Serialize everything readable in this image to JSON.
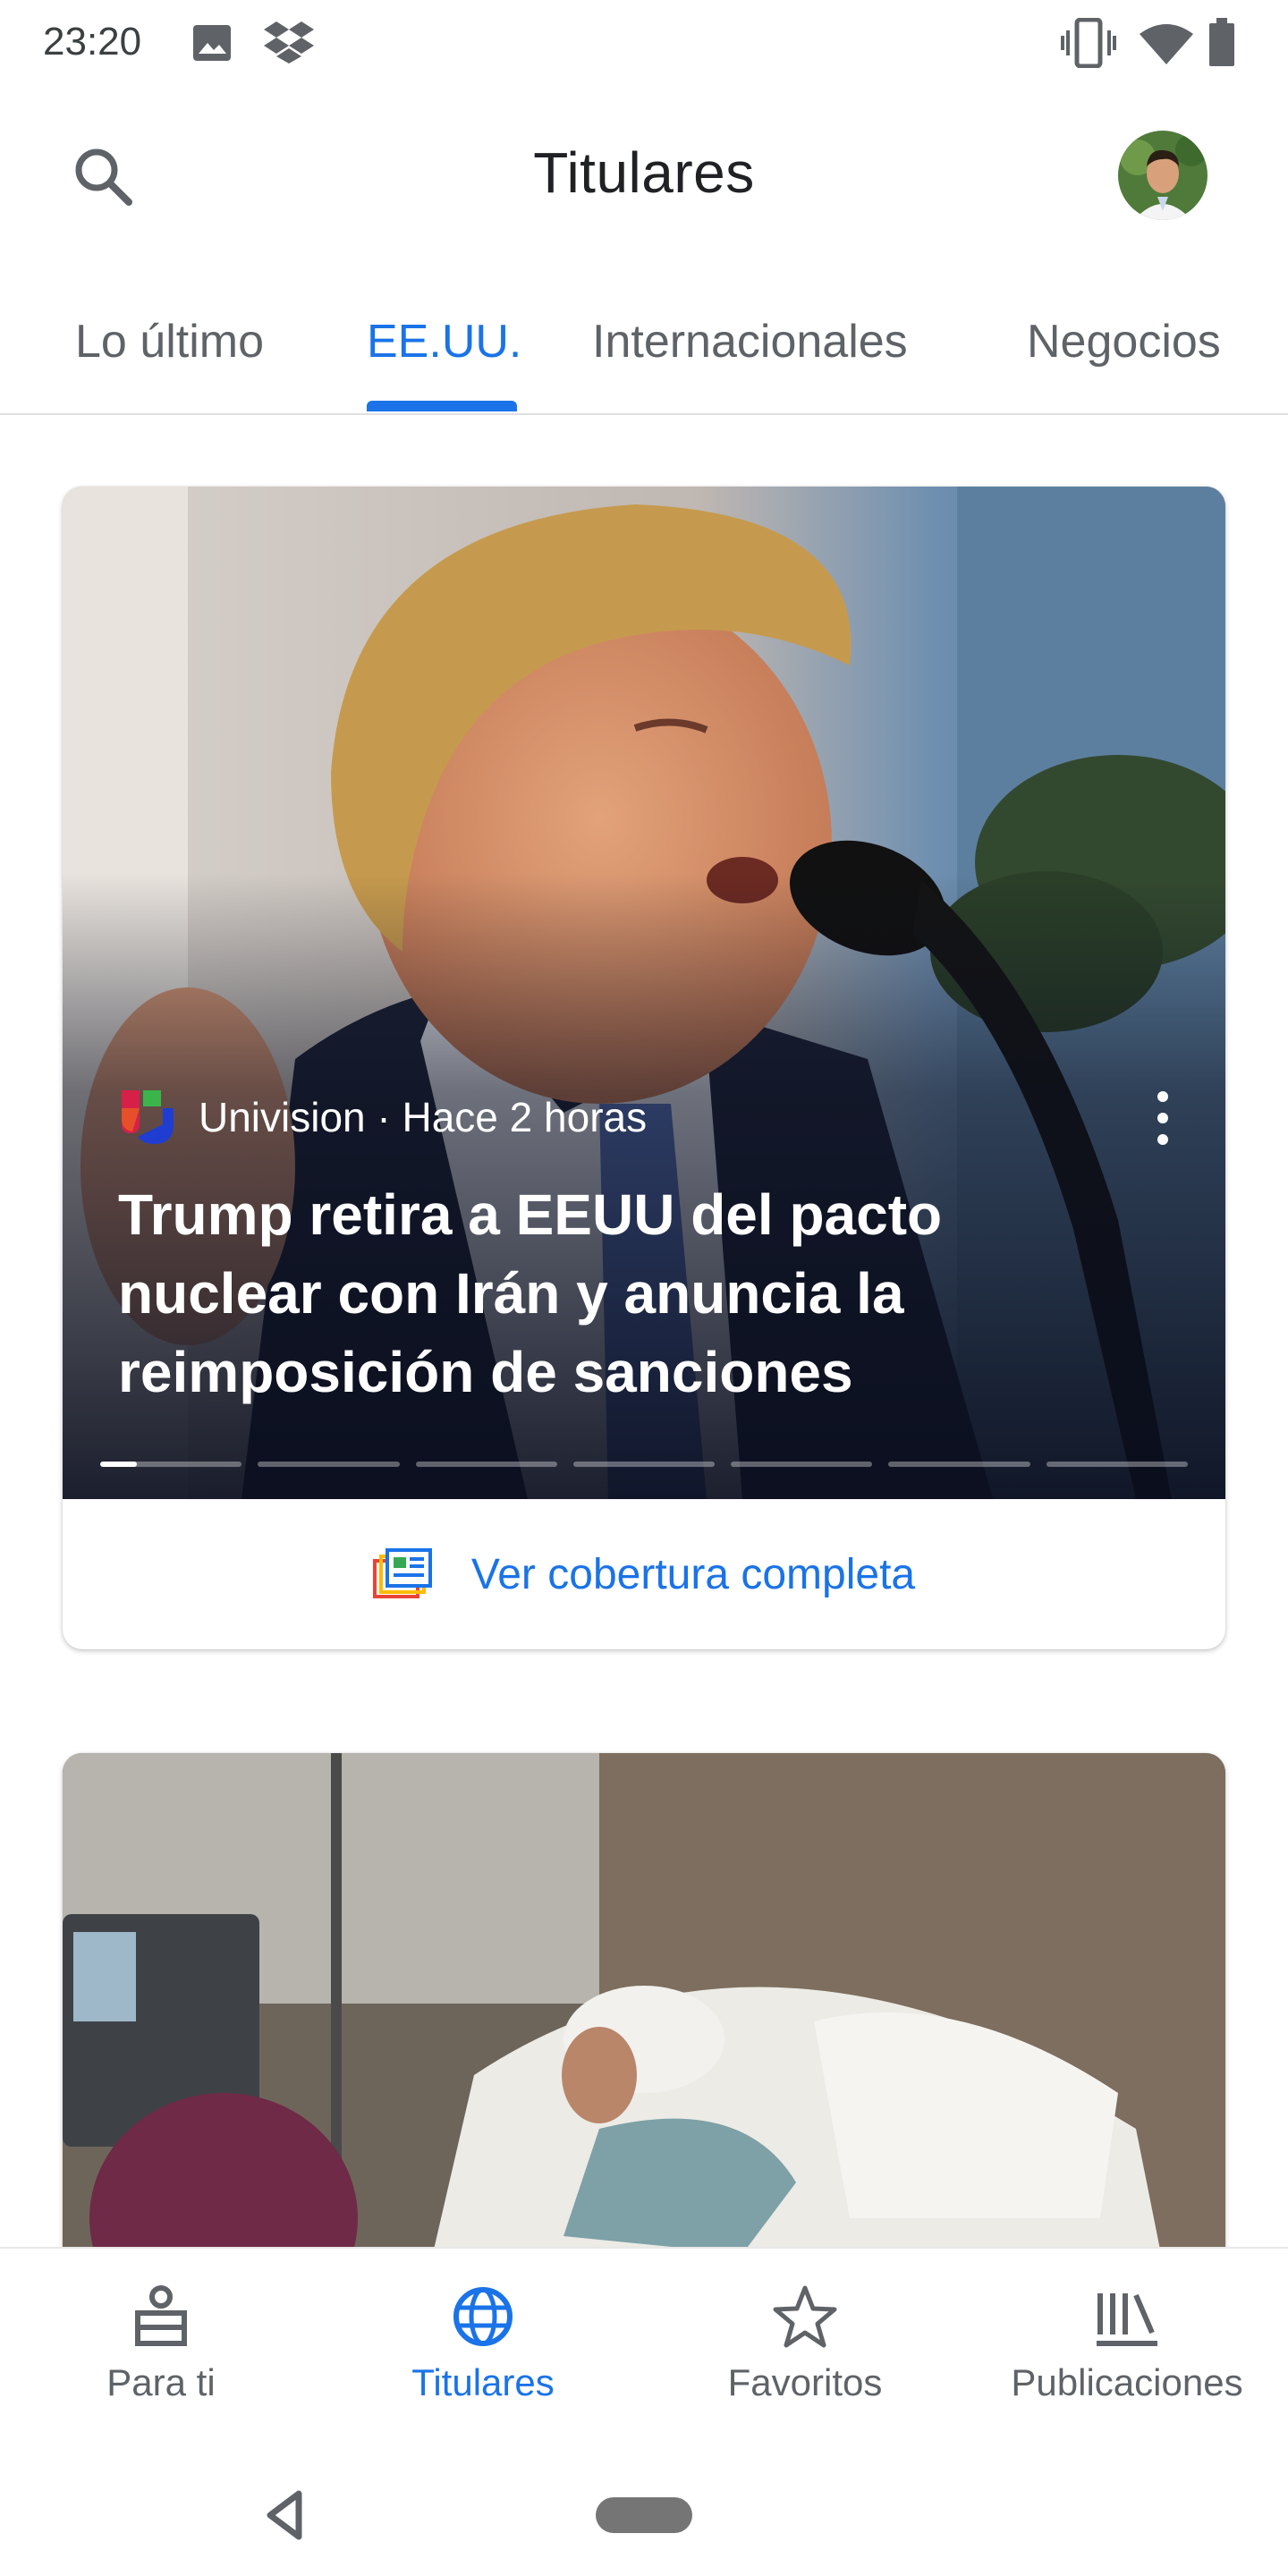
{
  "status_bar": {
    "time": "23:20",
    "icons": [
      "image-icon",
      "dropbox-icon",
      "vibrate-icon",
      "wifi-icon",
      "battery-icon"
    ]
  },
  "app_bar": {
    "title": "Titulares",
    "search_icon": "search-icon",
    "avatar": "account-avatar"
  },
  "tabs": [
    {
      "label": "Lo último",
      "active": false
    },
    {
      "label": "EE.UU.",
      "active": true
    },
    {
      "label": "Internacionales",
      "active": false
    },
    {
      "label": "Negocios",
      "active": false
    }
  ],
  "stories": [
    {
      "source": "Univision",
      "time": "Hace 2 horas",
      "source_line": "Univision · Hace 2 horas",
      "headline": "Trump retira a EEUU del pacto nuclear con Irán y anuncia la reimposición de sanciones",
      "carousel_position": 1,
      "carousel_count": 7,
      "coverage_label": "Ver cobertura completa"
    }
  ],
  "bottom_nav": [
    {
      "label": "Para ti",
      "icon": "for-you-icon",
      "active": false
    },
    {
      "label": "Titulares",
      "icon": "globe-icon",
      "active": true
    },
    {
      "label": "Favoritos",
      "icon": "star-icon",
      "active": false
    },
    {
      "label": "Publicaciones",
      "icon": "publications-icon",
      "active": false
    }
  ],
  "colors": {
    "accent": "#1a73e8",
    "text_primary": "#202124",
    "text_secondary": "#5f6368"
  }
}
